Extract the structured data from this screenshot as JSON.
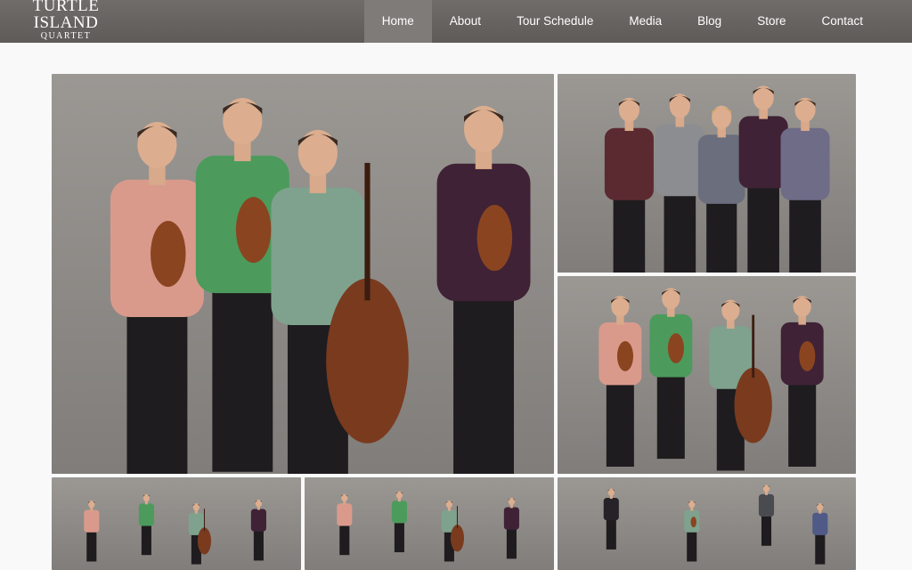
{
  "site": {
    "logo": {
      "line1": "TURTLE",
      "line2": "ISLAND",
      "line3": "QUARTET"
    }
  },
  "nav": {
    "items": [
      {
        "label": "Home",
        "active": true
      },
      {
        "label": "About"
      },
      {
        "label": "Tour Schedule"
      },
      {
        "label": "Media"
      },
      {
        "label": "Blog"
      },
      {
        "label": "Store"
      },
      {
        "label": "Contact"
      }
    ]
  },
  "colors": {
    "header": "#64615e",
    "nav_active": "#7e7b78",
    "page_background": "#f9f9fa",
    "photo_backdrop": "#8e8b88"
  },
  "gallery": {
    "photos": [
      {
        "name": "quartet-with-instruments-large",
        "people": [
          "pink-paisley-shirt-violin",
          "green-shirt-violin",
          "striped-shirt-cello",
          "purple-shirt-violin"
        ]
      },
      {
        "name": "five-people-group-photo",
        "people": [
          "maroon-striped-shirt",
          "grey-shirt",
          "blonde-woman",
          "purple-shirt",
          "floral-shirt"
        ]
      },
      {
        "name": "quartet-with-instruments-medium",
        "people": [
          "pink-shirt-violin",
          "green-shirt-violin",
          "striped-shirt-cello",
          "purple-shirt-violin"
        ]
      },
      {
        "name": "quartet-thumbnail-1",
        "people": [
          "pink-shirt",
          "green-shirt",
          "striped-shirt-cello",
          "purple-shirt"
        ]
      },
      {
        "name": "quartet-thumbnail-2",
        "people": [
          "pink-shirt",
          "green-shirt",
          "striped-shirt-cello",
          "purple-shirt"
        ]
      },
      {
        "name": "quartet-formal-thumbnail",
        "people": [
          "black-suit",
          "striped-shirt-violin",
          "dark-grey-shirt",
          "blue-shirt"
        ]
      }
    ]
  }
}
